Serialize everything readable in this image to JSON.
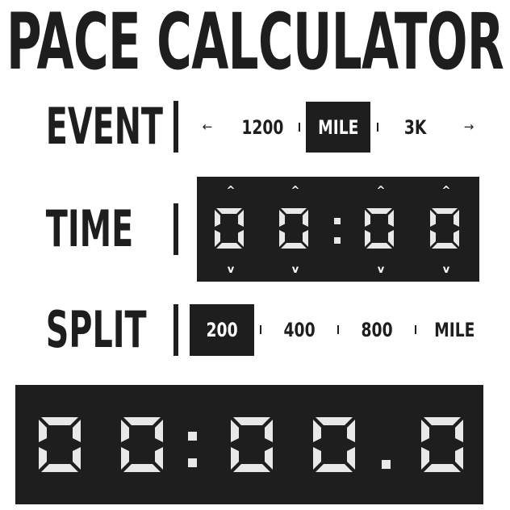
{
  "app": {
    "title": "PACE CALCULATOR"
  },
  "event": {
    "label": "EVENT",
    "prev_arrow": "←",
    "next_arrow": "→",
    "options": [
      "1200",
      "MILE",
      "3K"
    ],
    "selected": "MILE"
  },
  "time": {
    "label": "TIME",
    "up_arrow": "^",
    "down_arrow": "v",
    "digits": [
      "0",
      "0",
      "0",
      "0"
    ],
    "separator": ":"
  },
  "split": {
    "label": "SPLIT",
    "options": [
      "200",
      "400",
      "800",
      "MILE"
    ],
    "selected": "200"
  },
  "result": {
    "digits": [
      "0",
      "0",
      "0",
      "0",
      "0"
    ],
    "separators": [
      ":",
      "."
    ]
  },
  "colors": {
    "ink": "#1e1e1e",
    "background": "#ffffff",
    "segment": "#e8e8e8"
  }
}
